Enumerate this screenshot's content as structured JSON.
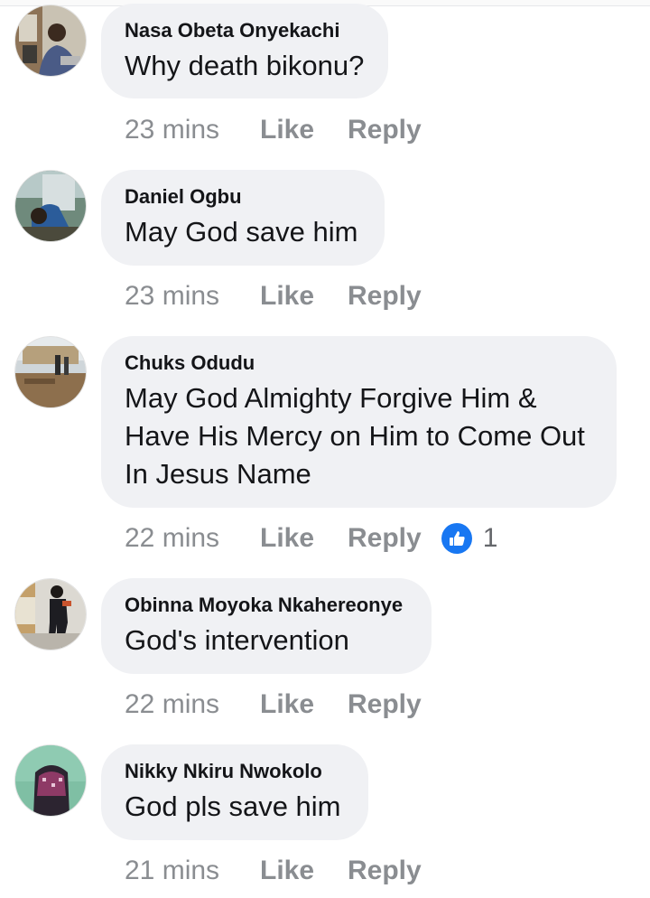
{
  "comments": [
    {
      "author": "Nasa Obeta Onyekachi",
      "text": "Why death bikonu?",
      "time": "23 mins",
      "like_label": "Like",
      "reply_label": "Reply"
    },
    {
      "author": "Daniel Ogbu",
      "text": "May God save him",
      "time": "23 mins",
      "like_label": "Like",
      "reply_label": "Reply"
    },
    {
      "author": "Chuks Odudu",
      "text_lines": [
        "May God Almighty Forgive Him &",
        "Have His Mercy on Him to Come Out",
        "In Jesus Name"
      ],
      "time": "22 mins",
      "like_label": "Like",
      "reply_label": "Reply",
      "reaction": {
        "icon": "thumbs-up-icon",
        "count": "1",
        "color": "#1877f2"
      }
    },
    {
      "author": "Obinna Moyoka Nkahereonye",
      "text": "God's intervention",
      "time": "22 mins",
      "like_label": "Like",
      "reply_label": "Reply"
    },
    {
      "author": "Nikky Nkiru Nwokolo",
      "text": "God pls save him",
      "time": "21 mins",
      "like_label": "Like",
      "reply_label": "Reply"
    }
  ],
  "colors": {
    "bubble_bg": "#f0f1f4",
    "action_text": "#8a8d91",
    "name_text": "#141518",
    "reaction_blue": "#1877f2"
  }
}
